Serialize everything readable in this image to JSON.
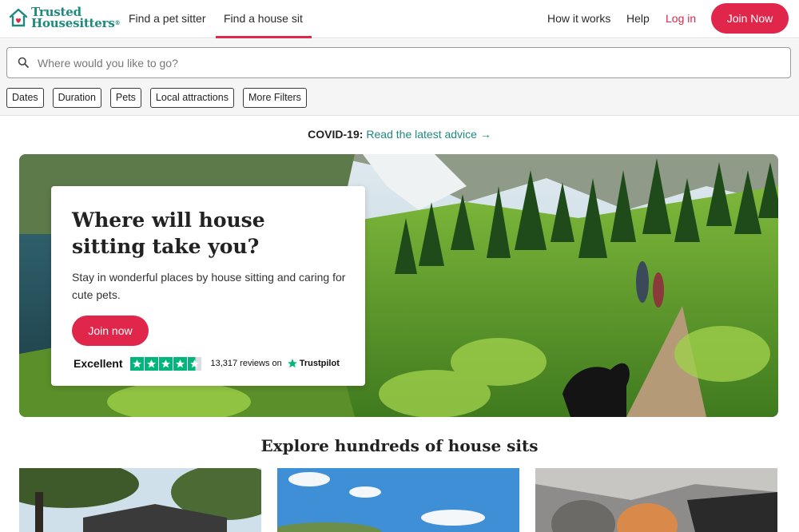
{
  "brand": {
    "line1": "Trusted",
    "line2": "Housesitters",
    "tm": "®",
    "color": "#1e8a7d"
  },
  "nav": {
    "find_pet_sitter": "Find a pet sitter",
    "find_house_sit": "Find a house sit",
    "how_it_works": "How it works",
    "help": "Help",
    "login": "Log in",
    "join": "Join Now"
  },
  "search": {
    "placeholder": "Where would you like to go?",
    "value": ""
  },
  "filters": [
    "Dates",
    "Duration",
    "Pets",
    "Local attractions",
    "More Filters"
  ],
  "covid": {
    "label": "COVID-19:",
    "link": "Read the latest advice",
    "arrow": "→"
  },
  "hero": {
    "title": "Where will house sitting take you?",
    "subtitle": "Stay in wonderful places by house sitting and caring for cute pets.",
    "button": "Join now",
    "rating_word": "Excellent",
    "stars": 4.5,
    "reviews": "13,317 reviews on",
    "trustpilot": "Trustpilot"
  },
  "explore": {
    "title": "Explore hundreds of house sits"
  },
  "colors": {
    "accent": "#e0264a",
    "brand": "#1e8a7d",
    "trustpilot": "#00b67a"
  }
}
